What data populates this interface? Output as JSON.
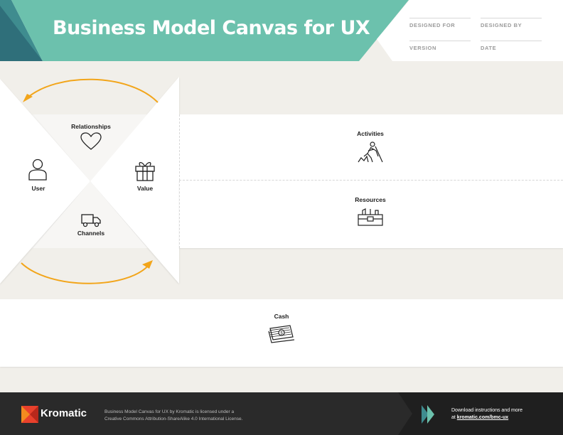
{
  "header": {
    "title": "Business Model Canvas for UX",
    "meta": {
      "designed_for": "DESIGNED FOR",
      "designed_by": "DESIGNED BY",
      "version": "VERSION",
      "date": "DATE"
    }
  },
  "canvas": {
    "relationships": {
      "label": "Relationships",
      "icon": "heart-icon"
    },
    "user": {
      "label": "User",
      "icon": "person-icon"
    },
    "value": {
      "label": "Value",
      "icon": "gift-icon"
    },
    "channels": {
      "label": "Channels",
      "icon": "truck-icon"
    },
    "activities": {
      "label": "Activities",
      "icon": "digging-worker-icon"
    },
    "resources": {
      "label": "Resources",
      "icon": "toolbox-icon"
    },
    "cash": {
      "label": "Cash",
      "icon": "money-stack-icon"
    }
  },
  "footer": {
    "brand": "Kromatic",
    "license_line1": "Business Model Canvas for UX by Kromatic is licensed under a",
    "license_line2": "Creative Commons Attribution-ShareAlike 4.0 International License.",
    "download_line1": "Download instructions and more",
    "download_prefix": "at ",
    "download_link": "kromatic.com/bmc-ux"
  },
  "colors": {
    "teal": "#6cc1ad",
    "teal_dark": "#2f7d86",
    "arrow_orange": "#f2a51a",
    "footer_bg": "#2a2a2a",
    "brand_red": "#e8412c"
  }
}
